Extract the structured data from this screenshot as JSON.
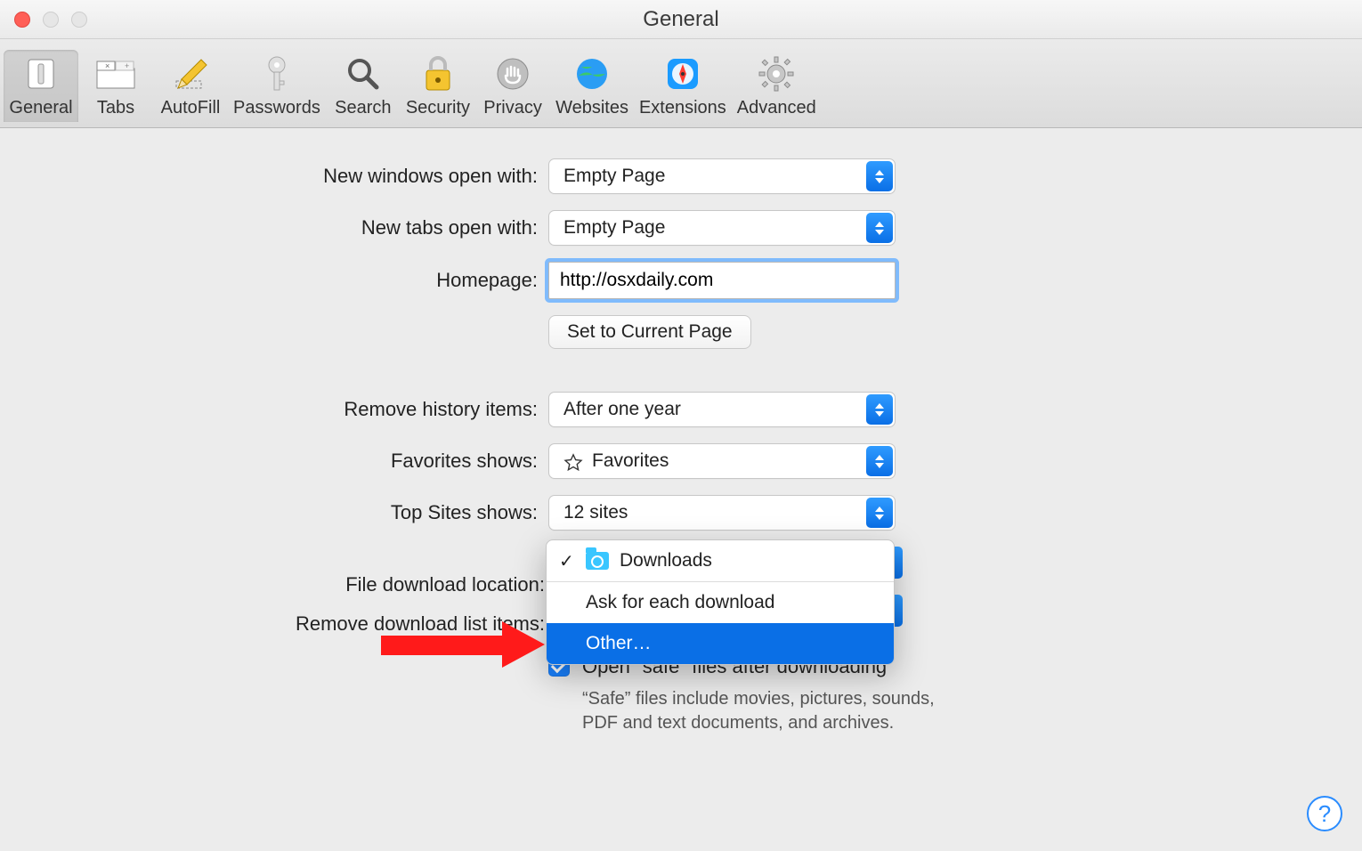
{
  "window": {
    "title": "General"
  },
  "toolbar": {
    "items": [
      {
        "label": "General",
        "icon": "switch-icon"
      },
      {
        "label": "Tabs",
        "icon": "tab-icon"
      },
      {
        "label": "AutoFill",
        "icon": "pencil-icon"
      },
      {
        "label": "Passwords",
        "icon": "key-icon"
      },
      {
        "label": "Search",
        "icon": "magnifier-icon"
      },
      {
        "label": "Security",
        "icon": "lock-icon"
      },
      {
        "label": "Privacy",
        "icon": "hand-icon"
      },
      {
        "label": "Websites",
        "icon": "globe-icon"
      },
      {
        "label": "Extensions",
        "icon": "compass-icon"
      },
      {
        "label": "Advanced",
        "icon": "gear-icon"
      }
    ]
  },
  "labels": {
    "new_windows": "New windows open with:",
    "new_tabs": "New tabs open with:",
    "homepage": "Homepage:",
    "set_current": "Set to Current Page",
    "remove_history": "Remove history items:",
    "favorites": "Favorites shows:",
    "top_sites": "Top Sites shows:",
    "download_loc": "File download location:",
    "remove_dl": "Remove download list items:",
    "open_safe": "Open \"safe\" files after downloading",
    "safe_sub": "“Safe” files include movies, pictures, sounds, PDF and text documents, and archives."
  },
  "values": {
    "new_windows": "Empty Page",
    "new_tabs": "Empty Page",
    "homepage": "http://osxdaily.com",
    "remove_history": "After one year",
    "favorites": "Favorites",
    "top_sites": "12 sites"
  },
  "download_menu": {
    "items": [
      {
        "label": "Downloads",
        "checked": true,
        "icon": "folder"
      },
      {
        "label": "Ask for each download"
      },
      {
        "label": "Other…",
        "selected": true
      }
    ]
  },
  "help_glyph": "?"
}
